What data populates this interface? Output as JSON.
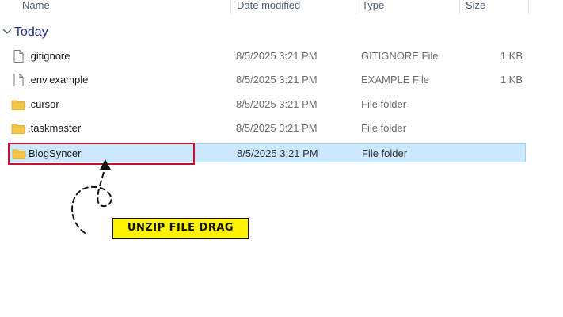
{
  "columns": {
    "name": "Name",
    "date_modified": "Date modified",
    "type": "Type",
    "size": "Size"
  },
  "group": {
    "label": "Today"
  },
  "files": [
    {
      "name": ".gitignore",
      "date": "8/5/2025 3:21 PM",
      "type": "GITIGNORE File",
      "size": "1 KB",
      "icon": "file-icon"
    },
    {
      "name": ".env.example",
      "date": "8/5/2025 3:21 PM",
      "type": "EXAMPLE File",
      "size": "1 KB",
      "icon": "file-icon"
    },
    {
      "name": ".cursor",
      "date": "8/5/2025 3:21 PM",
      "type": "File folder",
      "size": "",
      "icon": "folder-icon"
    },
    {
      "name": ".taskmaster",
      "date": "8/5/2025 3:21 PM",
      "type": "File folder",
      "size": "",
      "icon": "folder-icon"
    },
    {
      "name": "BlogSyncer",
      "date": "8/5/2025 3:21 PM",
      "type": "File folder",
      "size": "",
      "icon": "folder-icon",
      "selected": true
    }
  ],
  "annotation": {
    "label": "UNZIP FILE DRAG"
  },
  "colors": {
    "selection": "#cce8ff",
    "highlight": "#c8102e",
    "callout": "#fff200",
    "folder": "#f6c94b"
  }
}
